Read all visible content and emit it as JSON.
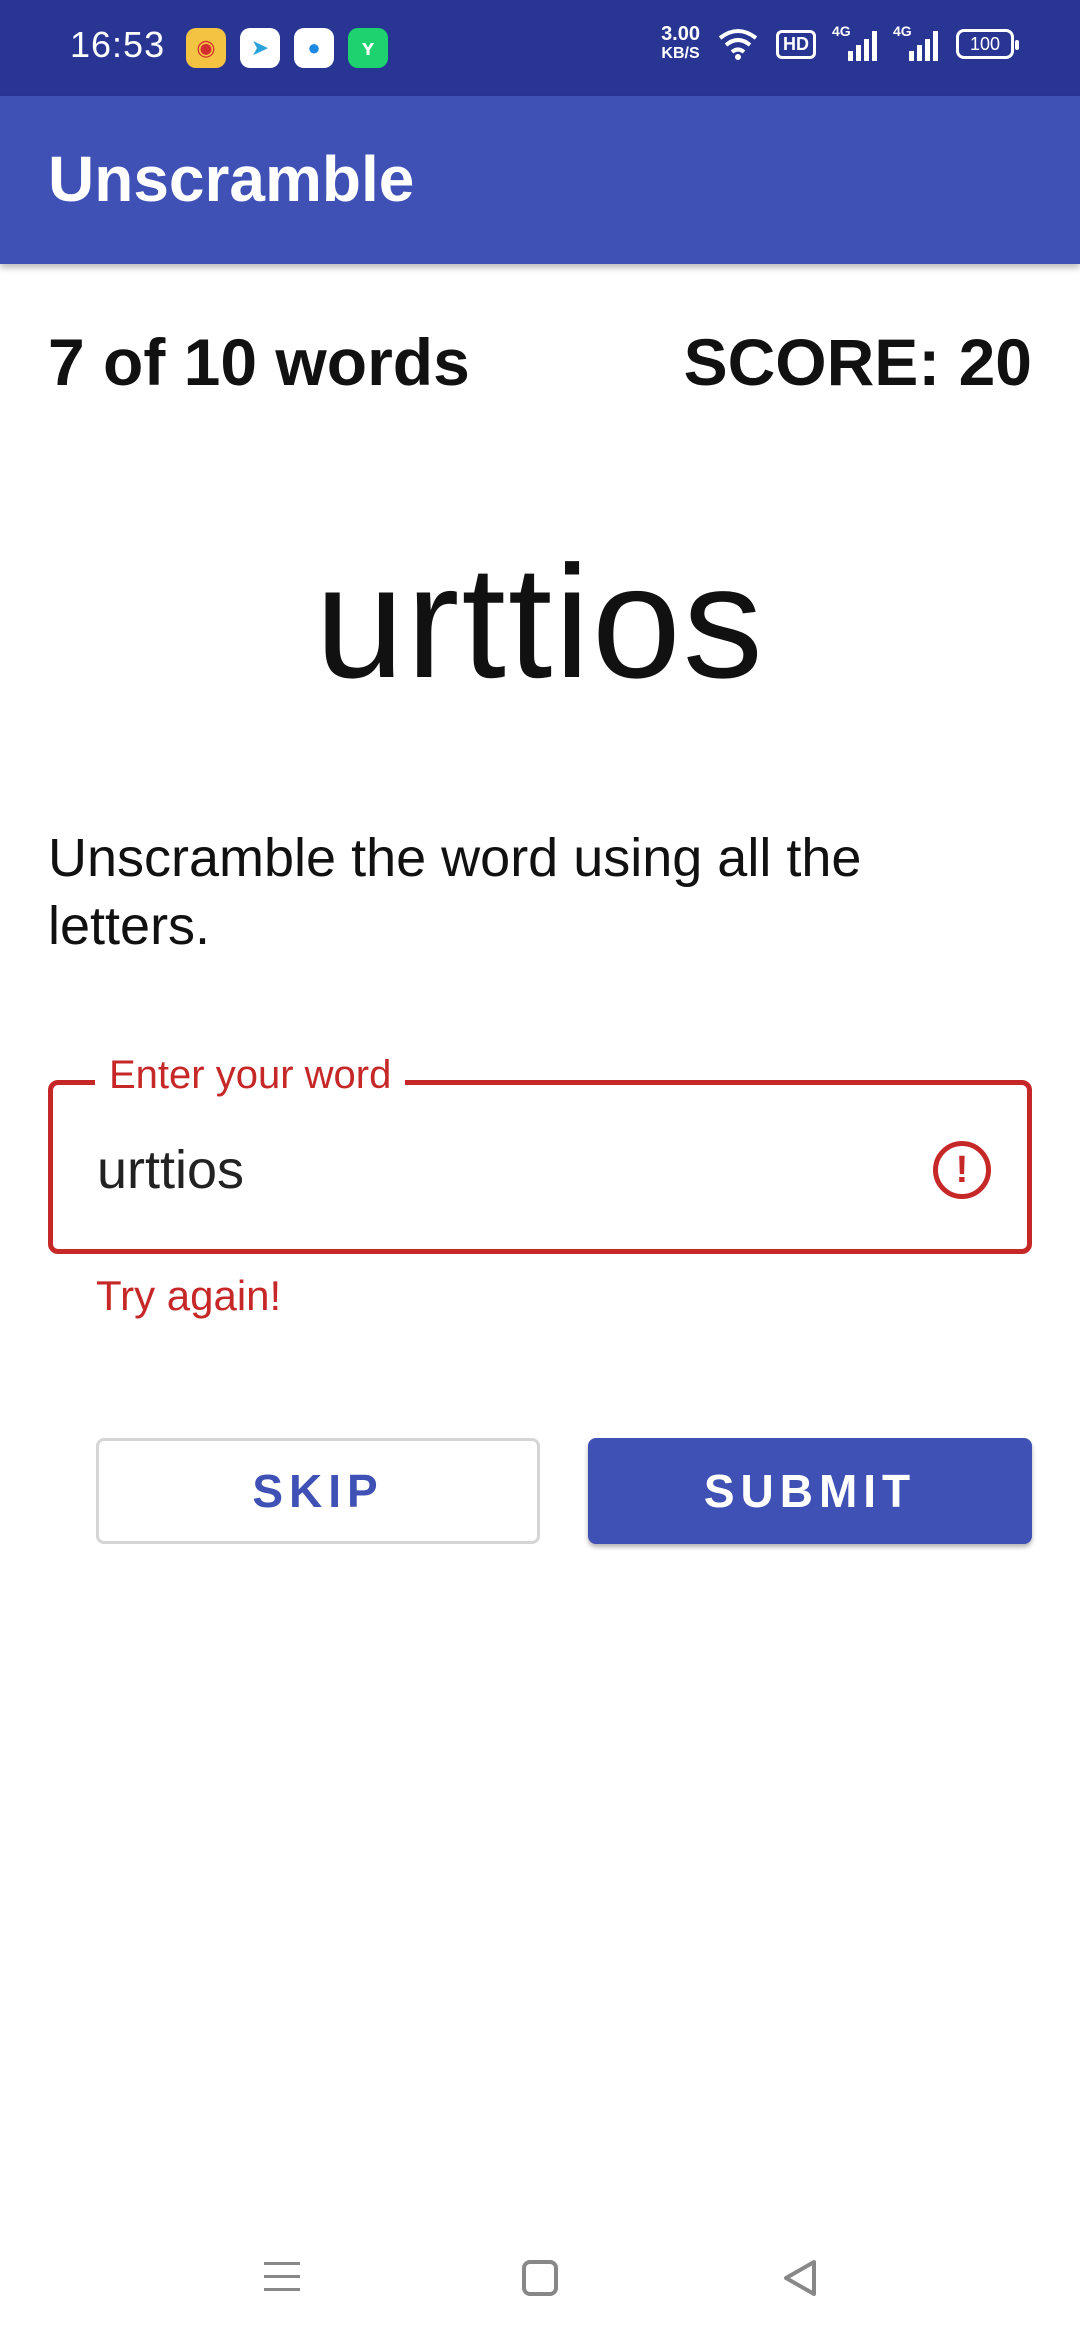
{
  "status_bar": {
    "time": "16:53",
    "net_speed_value": "3.00",
    "net_speed_unit": "KB/S",
    "hd_badge": "HD",
    "signal_1_label": "4G",
    "signal_2_label": "4G",
    "battery": "100",
    "notification_icons": [
      "weibo-icon",
      "telegram-icon",
      "chat-bubble-icon",
      "app-icon"
    ]
  },
  "app_bar": {
    "title": "Unscramble"
  },
  "game": {
    "word_count": "7 of 10 words",
    "score": "SCORE: 20",
    "scrambled_word": "urttios",
    "instructions": "Unscramble the word using all the letters."
  },
  "input": {
    "label": "Enter your word",
    "value": "urttios",
    "error_text": "Try again!",
    "error_icon": "error-icon"
  },
  "buttons": {
    "skip": "SKIP",
    "submit": "SUBMIT"
  },
  "colors": {
    "primary": "#3f51b5",
    "primary_dark": "#283593",
    "error": "#c62828"
  }
}
